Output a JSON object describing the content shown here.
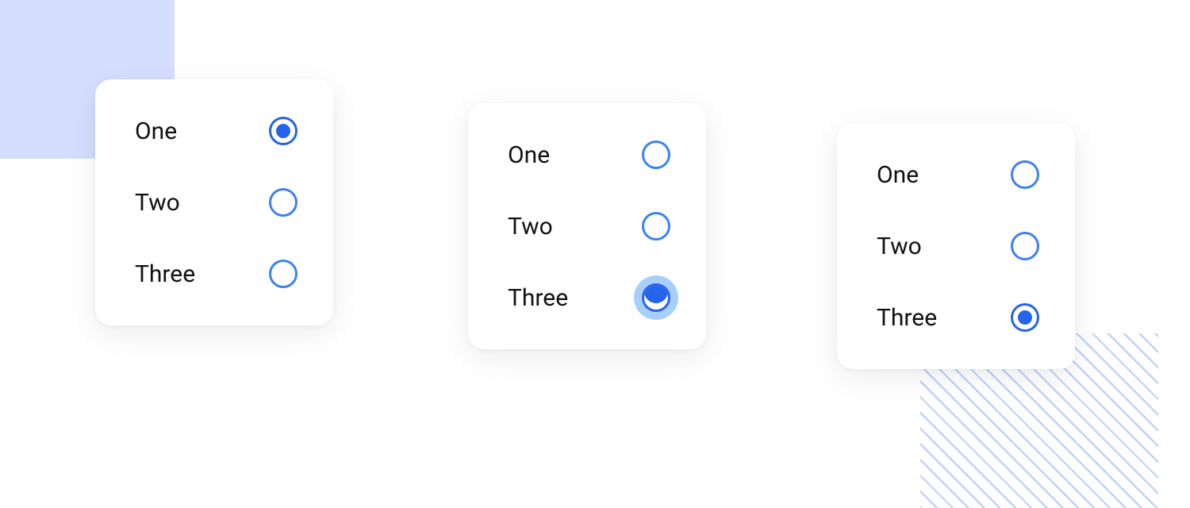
{
  "colors": {
    "primary": "#2563eb",
    "ring": "#60a5fa",
    "decoration_square": "#d6deff",
    "decoration_stripe": "#b9caff"
  },
  "cards": [
    {
      "options": [
        {
          "label": "One",
          "state": "selected"
        },
        {
          "label": "Two",
          "state": "unselected"
        },
        {
          "label": "Three",
          "state": "unselected"
        }
      ]
    },
    {
      "options": [
        {
          "label": "One",
          "state": "unselected"
        },
        {
          "label": "Two",
          "state": "unselected"
        },
        {
          "label": "Three",
          "state": "pressing"
        }
      ]
    },
    {
      "options": [
        {
          "label": "One",
          "state": "unselected"
        },
        {
          "label": "Two",
          "state": "unselected"
        },
        {
          "label": "Three",
          "state": "selected"
        }
      ]
    }
  ]
}
